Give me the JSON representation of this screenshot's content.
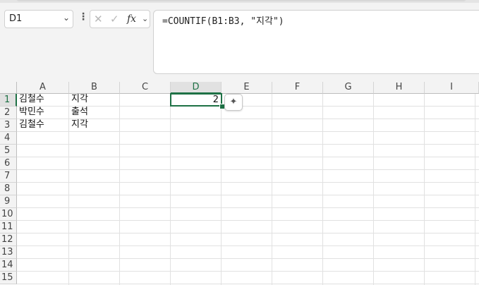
{
  "name_box": {
    "value": "D1"
  },
  "formula_bar": {
    "text": "=COUNTIF(B1:B3, \"지각\")",
    "fx_label": "fx"
  },
  "columns": [
    "A",
    "B",
    "C",
    "D",
    "E",
    "F",
    "G",
    "H",
    "I"
  ],
  "rows": [
    "1",
    "2",
    "3",
    "4",
    "5",
    "6",
    "7",
    "8",
    "9",
    "10",
    "11",
    "12",
    "13",
    "14",
    "15"
  ],
  "cells": {
    "A1": "김철수",
    "B1": "지각",
    "A2": "박민수",
    "B2": "출석",
    "A3": "김철수",
    "B3": "지각",
    "D1": "2"
  },
  "selected": {
    "column": "D",
    "row": "1"
  },
  "accent_color": "#1e7145"
}
